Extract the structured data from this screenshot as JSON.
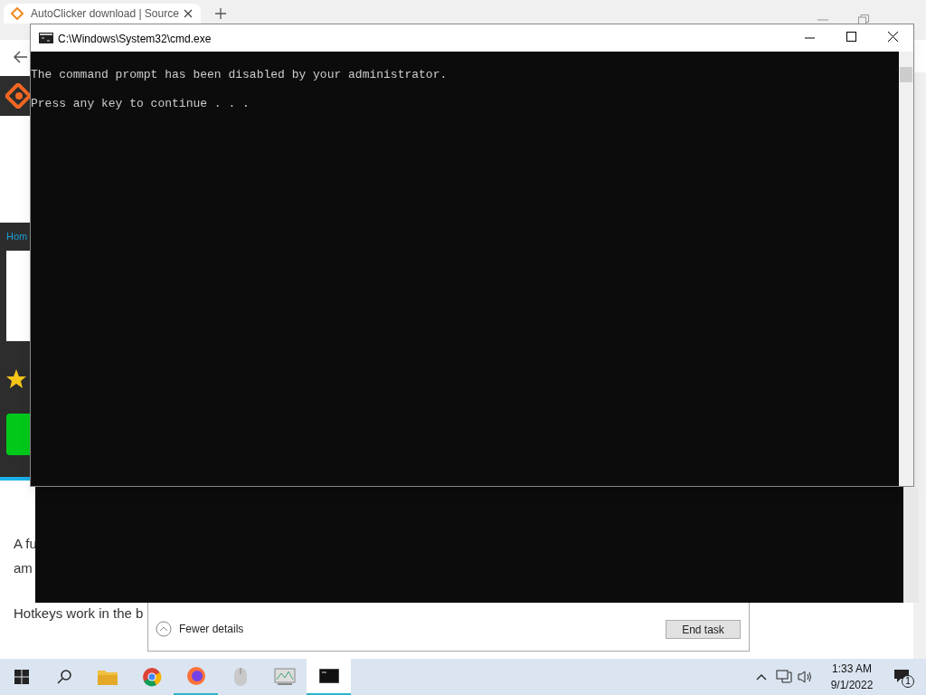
{
  "browser": {
    "tab": {
      "title": "AutoClicker download | Source",
      "selected": true
    },
    "breadcrumb": "Hom",
    "paragraphs": [
      "A fu",
      "am",
      "Hotkeys work in the b"
    ]
  },
  "task_dialog": {
    "toggle": "Fewer details",
    "button": "End task"
  },
  "console": {
    "title": "C:\\Windows\\System32\\cmd.exe",
    "lines": [
      "The command prompt has been disabled by your administrator.",
      "Press any key to continue . . ."
    ]
  },
  "taskbar": {
    "apps": [
      {
        "kind": "folder",
        "selected": false
      },
      {
        "kind": "chrome",
        "selected": false
      },
      {
        "kind": "firefox",
        "selected": true
      },
      {
        "kind": "mouse",
        "selected": false
      },
      {
        "kind": "monitor",
        "selected": false
      },
      {
        "kind": "console",
        "selected": true
      }
    ],
    "time": "1:33 AM",
    "date": "9/1/2022",
    "notifications": "1"
  }
}
